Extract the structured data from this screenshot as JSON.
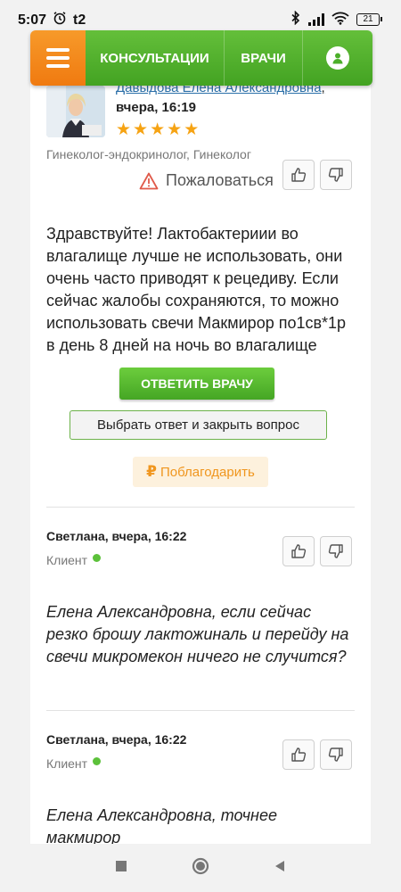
{
  "status_bar": {
    "time": "5:07",
    "carrier": "t2",
    "battery": "21"
  },
  "nav": {
    "consultations": "КОНСУЛЬТАЦИИ",
    "doctors": "ВРАЧИ"
  },
  "doctor_answer": {
    "doctor_name": "Давыдова Елена Александровна",
    "name_comma": ",",
    "date": "вчера, 16:19",
    "rating_stars": 5,
    "specialty": "Гинеколог-эндокринолог, Гинеколог",
    "complain_label": "Пожаловаться",
    "text": "Здравствуйте! Лактобактериии во влагалище лучше не использовать, они очень часто приводят к рецедиву. Если сейчас жалобы сохраняются, то можно использовать свечи Макмирор по1св*1р в день 8 дней на ночь во влагалище",
    "reply_button": "ОТВЕТИТЬ ВРАЧУ",
    "choose_button": "Выбрать ответ и закрыть вопрос",
    "thank_currency": "₽",
    "thank_button": "Поблагодарить"
  },
  "client_messages": [
    {
      "author_date": "Светлана, вчера, 16:22",
      "role": "Клиент",
      "text": "Елена Александровна, если сейчас резко брошу лактожиналь и перейду на свечи микромекон ничего не случится?"
    },
    {
      "author_date": "Светлана, вчера, 16:22",
      "role": "Клиент",
      "text": "Елена Александровна, точнее макмирор"
    }
  ],
  "colors": {
    "nav_green": "#4caf2a",
    "menu_orange": "#f28a1b",
    "star": "#f6a313",
    "link": "#2b6fa8",
    "online_dot": "#5cc13a"
  }
}
